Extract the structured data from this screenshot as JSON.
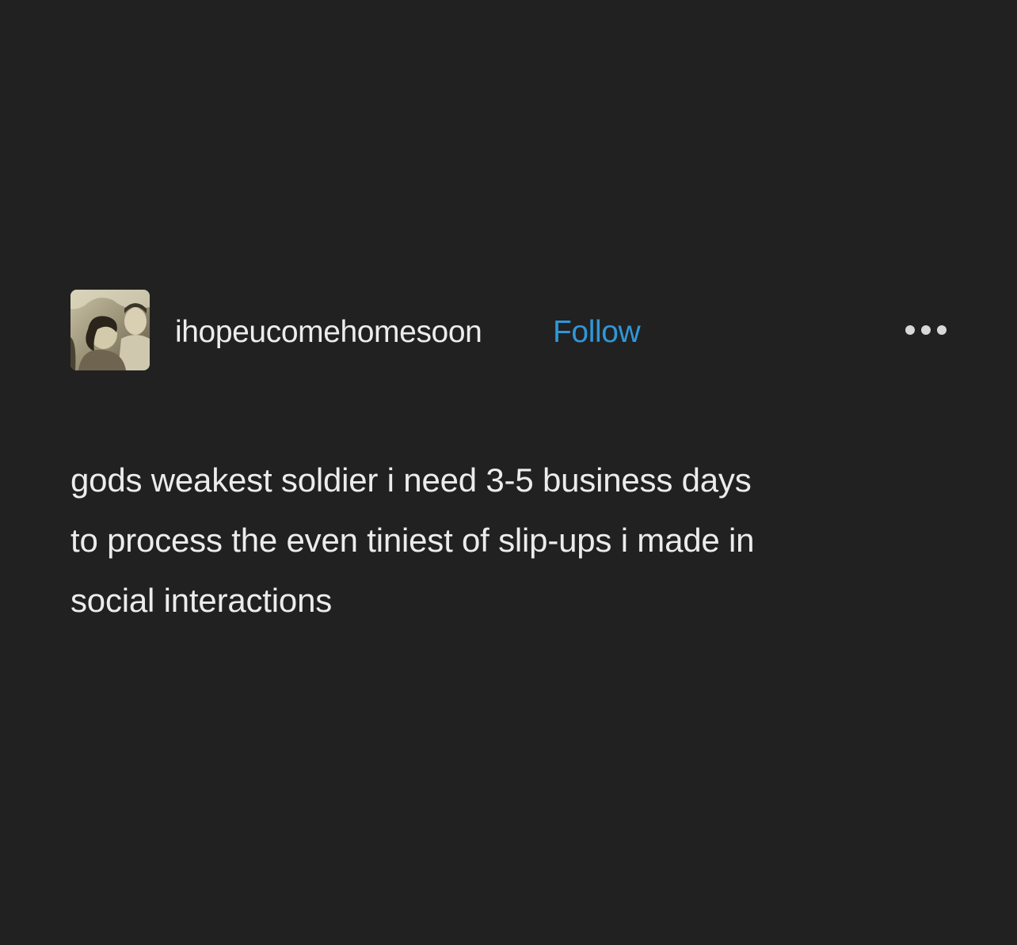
{
  "post": {
    "username": "ihopeucomehomesoon",
    "follow_label": "Follow",
    "body_lines": [
      "gods weakest soldier i need 3-5 business days",
      "to process the even tiniest of slip-ups i made in",
      "social interactions"
    ]
  },
  "colors": {
    "background": "#212121",
    "text": "#ececec",
    "accent": "#2f97d8"
  },
  "icons": {
    "more": "more-horizontal-icon",
    "avatar": "avatar-photo"
  }
}
